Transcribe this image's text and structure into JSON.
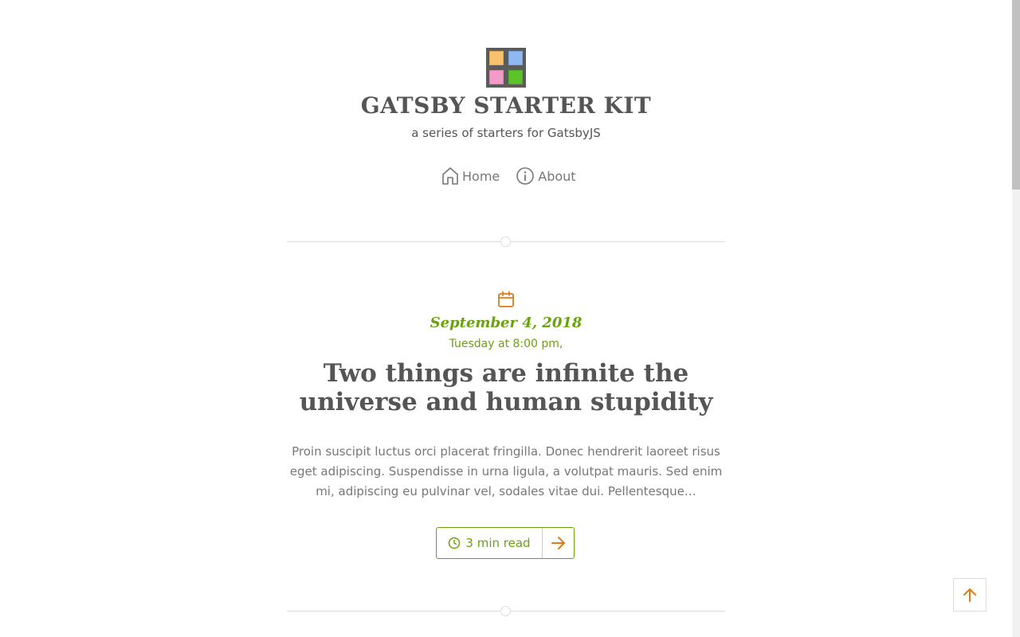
{
  "site": {
    "title": "GATSBY STARTER KIT",
    "subtitle": "a series of starters for GatsbyJS",
    "logo_colors": [
      "#f7c26b",
      "#8fb8f3",
      "#f29ac8",
      "#5bc22a"
    ],
    "logo_frame_color": "#5b5b5b"
  },
  "nav": {
    "items": [
      {
        "label": "Home",
        "icon": "home-icon"
      },
      {
        "label": "About",
        "icon": "info-icon"
      }
    ]
  },
  "post": {
    "date": "September 4, 2018",
    "time": "Tuesday at 8:00 pm,",
    "title": "Two things are infinite the universe and human stupidity",
    "excerpt": "Proin suscipit luctus orci placerat fringilla. Donec hendrerit laoreet risus eget adipiscing. Suspendisse in urna ligula, a volutpat mauris. Sed enim mi, adipiscing eu pulvinar vel, sodales vitae dui. Pellentesque…",
    "read_time": "3 min read",
    "calendar_icon": "calendar-icon",
    "clock_icon": "clock-icon",
    "arrow_icon": "arrow-right-icon"
  },
  "back_to_top": {
    "icon": "arrow-up-icon"
  },
  "colors": {
    "accent_green": "#6aa10f",
    "accent_orange": "#e07a14",
    "text": "#555555",
    "muted_text": "#777777",
    "divider": "#dddddd"
  }
}
